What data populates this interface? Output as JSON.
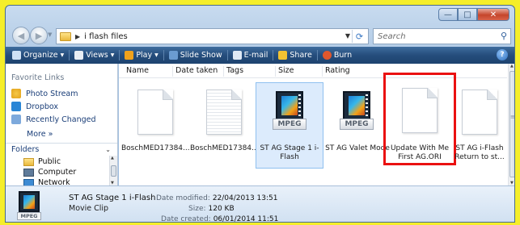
{
  "window": {
    "buttons": {
      "minimize": "—",
      "maximize": "□",
      "close": "✕"
    }
  },
  "address": {
    "path": "i flash files",
    "search_placeholder": "Search"
  },
  "toolbar": {
    "items": [
      "Organize",
      "Views",
      "Play",
      "Slide Show",
      "E-mail",
      "Share",
      "Burn"
    ]
  },
  "favorites": {
    "title": "Favorite Links",
    "items": [
      "Photo Stream",
      "Dropbox",
      "Recently Changed"
    ],
    "more": "More »"
  },
  "folders": {
    "title": "Folders",
    "items": [
      "Public",
      "Computer",
      "Network"
    ]
  },
  "columns": [
    "Name",
    "Date taken",
    "Tags",
    "Size",
    "Rating"
  ],
  "files": [
    {
      "label": "BoschMED17384...",
      "icon": "document-icon"
    },
    {
      "label": "BoschMED17384...",
      "icon": "lined-document-icon"
    },
    {
      "label": "ST AG Stage 1 i-Flash",
      "icon": "mpeg-video-icon",
      "badge": "MPEG"
    },
    {
      "label": "ST AG Valet Mode",
      "icon": "mpeg-video-icon",
      "badge": "MPEG"
    },
    {
      "label": "Update With Me First AG.ORI",
      "icon": "document-icon"
    },
    {
      "label": "ST AG i-Flash Return to st...",
      "icon": "document-icon"
    }
  ],
  "details": {
    "name": "ST AG Stage 1 i-Flash",
    "type": "Movie Clip",
    "badge": "MPEG",
    "date_modified_label": "Date modified:",
    "date_modified": "22/04/2013 13:51",
    "size_label": "Size:",
    "size": "120 KB",
    "date_created_label": "Date created:",
    "date_created": "06/01/2014 11:51"
  },
  "colors": {
    "page_background": "#f5ee2a",
    "highlight_box": "#ea1111",
    "toolbar": "#254d7c",
    "selection": "#dcebfc"
  }
}
